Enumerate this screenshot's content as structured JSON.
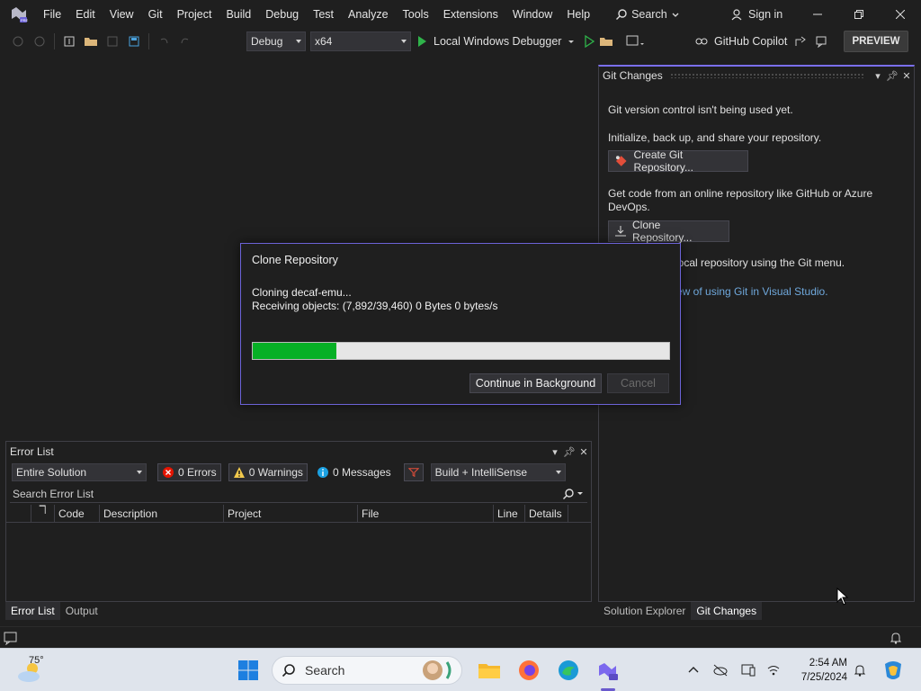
{
  "menu": {
    "items": [
      "File",
      "Edit",
      "View",
      "Git",
      "Project",
      "Build",
      "Debug",
      "Test",
      "Analyze",
      "Tools",
      "Extensions",
      "Window",
      "Help"
    ],
    "search_label": "Search",
    "signin_label": "Sign in"
  },
  "toolbar": {
    "config": "Debug",
    "platform": "x64",
    "run_label": "Local Windows Debugger",
    "copilot_label": "GitHub Copilot",
    "preview_label": "PREVIEW"
  },
  "git_panel": {
    "title": "Git Changes",
    "line1": "Git version control isn't being used yet.",
    "line2": "Initialize, back up, and share your repository.",
    "create_button": "Create Git Repository...",
    "line3a": "Get code from an online repository like GitHub or Azure",
    "line3b": "DevOps.",
    "clone_button": "Clone Repository...",
    "line4_partial": "g local repository using the Git menu.",
    "link_partial": "ew of using Git in Visual Studio."
  },
  "right_tabs": [
    "Solution Explorer",
    "Git Changes"
  ],
  "error_list": {
    "title": "Error List",
    "scope": "Entire Solution",
    "errors": "0 Errors",
    "warnings": "0 Warnings",
    "messages": "0 Messages",
    "source": "Build + IntelliSense",
    "search_placeholder": "Search Error List",
    "columns": [
      "Code",
      "Description",
      "Project",
      "File",
      "Line",
      "Details"
    ]
  },
  "bottom_tabs": [
    "Error List",
    "Output"
  ],
  "dialog": {
    "title": "Clone Repository",
    "status_line1": "Cloning decaf-emu...",
    "status_line2": "Receiving objects: (7,892/39,460) 0 Bytes 0 bytes/s",
    "progress_fraction": 0.2,
    "continue_button": "Continue in Background",
    "cancel_button": "Cancel"
  },
  "taskbar": {
    "temperature": "75°",
    "search_label": "Search",
    "time": "2:54 AM",
    "date": "7/25/2024"
  },
  "colors": {
    "accent": "#6c63d8",
    "progress": "#06b025",
    "link": "#6fa8dc"
  }
}
